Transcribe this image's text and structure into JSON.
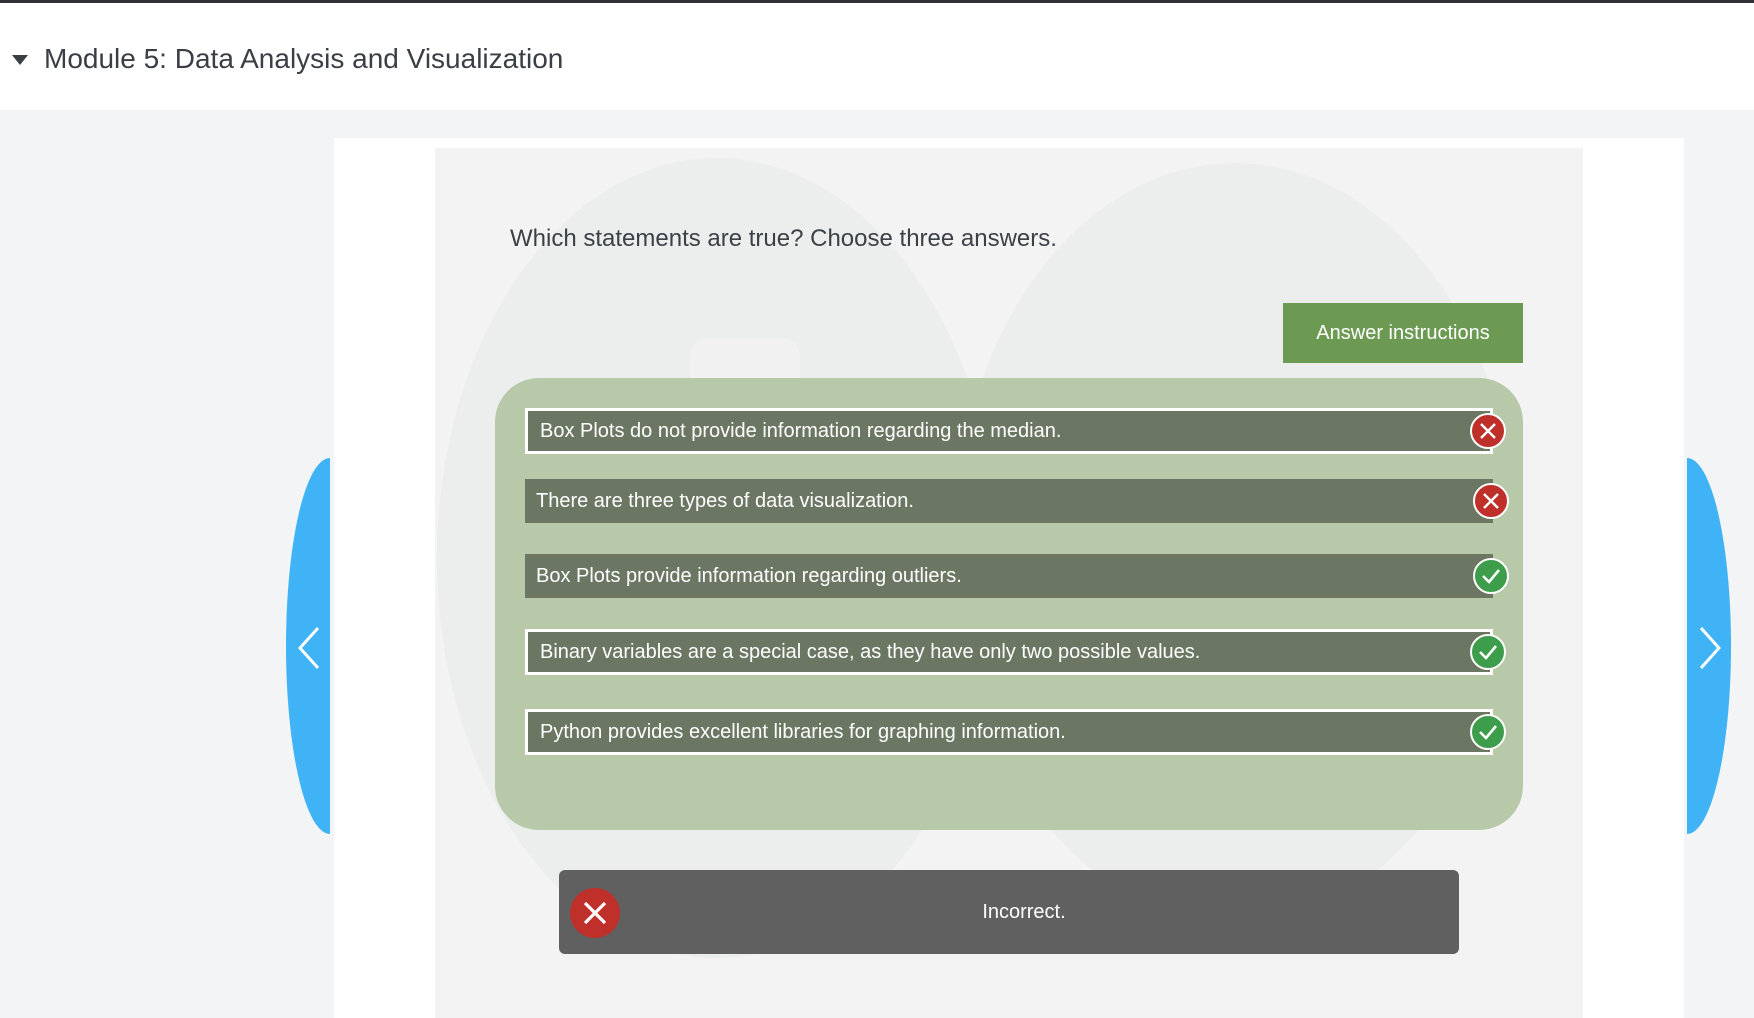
{
  "module": {
    "title": "Module 5: Data Analysis and Visualization",
    "icon": "caret-down-icon"
  },
  "question": {
    "text": "Which statements are true? Choose three answers.",
    "instructions_label": "Answer instructions"
  },
  "options": [
    {
      "text": "Box Plots do not provide information regarding the median.",
      "status": "incorrect",
      "icon": "x-circle-icon",
      "selected": true
    },
    {
      "text": "There are three types of data visualization.",
      "status": "incorrect",
      "icon": "x-circle-icon",
      "selected": false
    },
    {
      "text": "Box Plots provide information regarding outliers.",
      "status": "correct",
      "icon": "check-circle-icon",
      "selected": false
    },
    {
      "text": "Binary variables are a special case, as they have only two possible values.",
      "status": "correct",
      "icon": "check-circle-icon",
      "selected": true
    },
    {
      "text": "Python provides excellent libraries for graphing information.",
      "status": "correct",
      "icon": "check-circle-icon",
      "selected": true
    }
  ],
  "feedback": {
    "text": "Incorrect.",
    "icon": "x-circle-icon"
  },
  "navigation": {
    "prev_icon": "chevron-left-icon",
    "next_icon": "chevron-right-icon"
  },
  "colors": {
    "accent_green": "#6d9a52",
    "panel_green": "#b7c9a8",
    "option_bg": "#6b7763",
    "incorrect_red": "#c0302b",
    "correct_green": "#3e9d4b",
    "nav_blue": "#3fb3f5",
    "feedback_bg": "#606060"
  }
}
